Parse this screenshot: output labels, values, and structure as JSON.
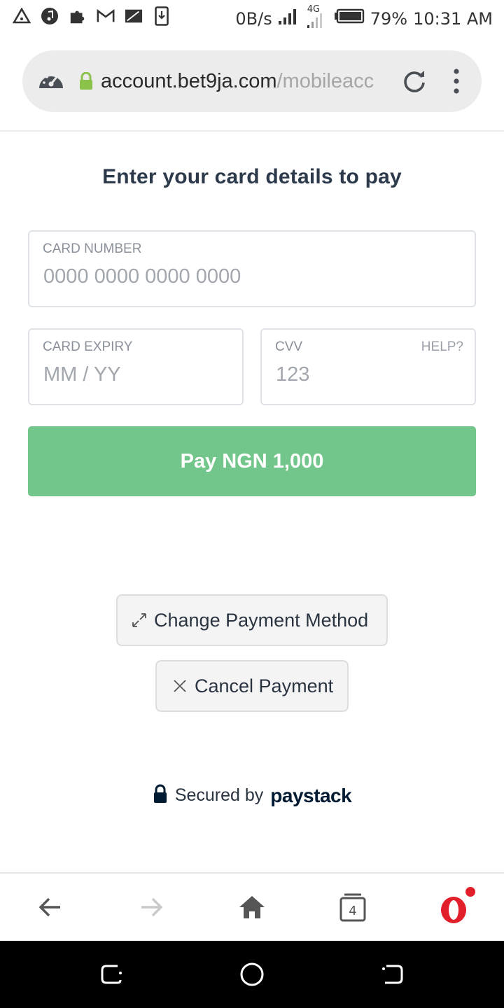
{
  "status_bar": {
    "net_speed": "0B/s",
    "network_type": "4G",
    "battery": "79%",
    "time": "10:31 AM"
  },
  "browser": {
    "url_host": "account.bet9ja.com",
    "url_path": "/mobileacc",
    "tab_count": "4"
  },
  "payment": {
    "heading": "Enter your card details to pay",
    "card_number_label": "CARD NUMBER",
    "card_number_placeholder": "0000 0000 0000 0000",
    "expiry_label": "CARD EXPIRY",
    "expiry_placeholder": "MM / YY",
    "cvv_label": "CVV",
    "cvv_help": "HELP?",
    "cvv_placeholder": "123",
    "pay_button": "Pay NGN 1,000",
    "change_method_button": "Change Payment Method",
    "cancel_button": "Cancel Payment",
    "secured_by": "Secured by",
    "brand": "paystack"
  },
  "colors": {
    "pay_button": "#72c68b",
    "secure_lock": "#8bc34a",
    "opera_red": "#e01f2b"
  }
}
